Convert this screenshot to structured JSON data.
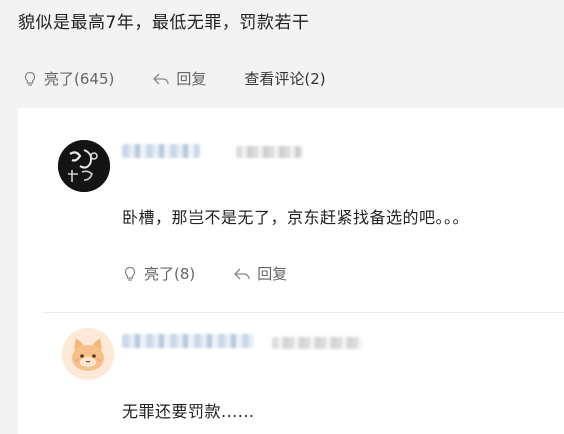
{
  "post": {
    "text": "貌似是最高7年，最低无罪，罚款若干",
    "like_label": "亮了(645)",
    "reply_label": "回复",
    "view_comments_label": "查看评论(2)"
  },
  "comments": [
    {
      "text": "卧槽，那岂不是无了，京东赶紧找备选的吧。。。",
      "like_label": "亮了(8)",
      "reply_label": "回复",
      "avatar_icon": "ink-calligraphy-avatar"
    },
    {
      "text": "无罪还要罚款......",
      "avatar_icon": "cat-avatar"
    }
  ],
  "colors": {
    "page_bg": "#f3f3f3",
    "panel_bg": "#ffffff",
    "text": "#222222",
    "muted": "#666666"
  }
}
